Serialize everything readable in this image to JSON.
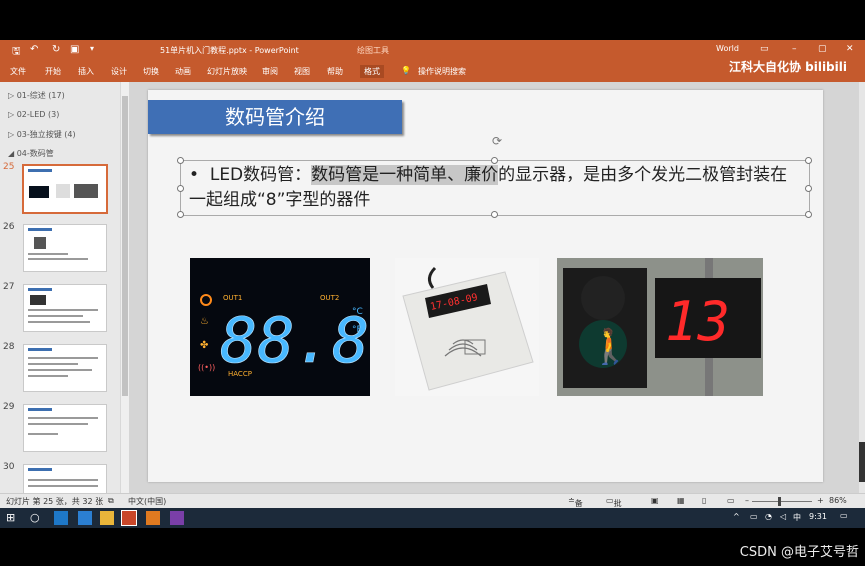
{
  "titlebar": {
    "file_title": "51单片机入门教程.pptx - PowerPoint",
    "context_tab": "绘图工具",
    "account": "World",
    "qat_icons": [
      "save-icon",
      "undo-icon",
      "redo-icon",
      "start-from-beginning-icon",
      "customize-qat-icon"
    ],
    "window_controls": [
      "ribbon-display-icon",
      "minimize-icon",
      "maximize-icon",
      "close-icon"
    ]
  },
  "ribbon": {
    "tabs": [
      "文件",
      "开始",
      "插入",
      "设计",
      "切换",
      "动画",
      "幻灯片放映",
      "审阅",
      "视图",
      "帮助",
      "格式"
    ],
    "active_tab": "格式",
    "tell_me": "操作说明搜索"
  },
  "brand": {
    "text": "江科大自化协 bilibili"
  },
  "left_pane": {
    "sections": [
      {
        "label": "01-综述 (17)",
        "state": "collapsed"
      },
      {
        "label": "02-LED (3)",
        "state": "collapsed"
      },
      {
        "label": "03-独立按键 (4)",
        "state": "collapsed"
      },
      {
        "label": "04-数码管",
        "state": "expanded"
      }
    ],
    "slides": [
      {
        "num": "25",
        "active": true
      },
      {
        "num": "26",
        "active": false
      },
      {
        "num": "27",
        "active": false
      },
      {
        "num": "28",
        "active": false
      },
      {
        "num": "29",
        "active": false
      },
      {
        "num": "30",
        "active": false
      }
    ]
  },
  "slide": {
    "title": "数码管介绍",
    "bullet": "•",
    "text_prefix": "LED数码管：",
    "text_highlight": "数码管是一种简单、廉价",
    "text_rest": "的显示器，是由多个发光二极管封装在一起组成“8”字型的器件"
  },
  "images": {
    "led_display": {
      "digits": "88.8",
      "label_out1": "OUT1",
      "label_out2": "OUT2",
      "label_c": "°C",
      "label_f": "°F",
      "label_haccp": "HACCP"
    },
    "card_reader": {
      "display": "17-08-09"
    },
    "traffic_signal": {
      "countdown": "13"
    }
  },
  "statusbar": {
    "slide_info": "幻灯片 第 25 张，共 32 张",
    "language": "中文(中国)",
    "notes": "备注",
    "comments": "批注",
    "zoom": "86%"
  },
  "taskbar": {
    "time": "9:31",
    "ime": "中",
    "icons": [
      "windows-start-icon",
      "search-icon",
      "edge-icon",
      "store-icon",
      "file-explorer-icon",
      "powerpoint-icon",
      "app-icon",
      "app2-icon"
    ]
  },
  "watermark": "CSDN @电子艾号哲",
  "colors": {
    "ppt_orange": "#c55a2d",
    "title_blue": "#3f6fb5",
    "led_blue": "#48b8ff",
    "seg_red": "#ff2a2a"
  }
}
